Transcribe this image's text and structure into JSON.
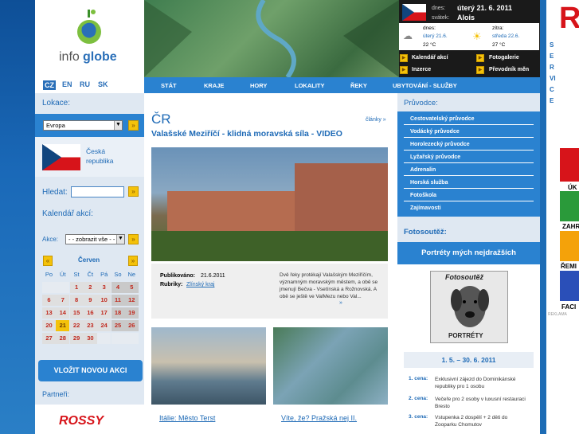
{
  "logo": {
    "text_info": "info",
    "text_globe": "globe"
  },
  "languages": [
    "CZ",
    "EN",
    "RU",
    "SK"
  ],
  "left": {
    "lokace_label": "Lokace:",
    "region_value": "Evropa",
    "country": "Česká republika",
    "search_label": "Hledat:",
    "calendar_label": "Kalendář akcí:",
    "events_label": "Akce:",
    "events_value": "- - zobrazit vše - -",
    "month": "Červen",
    "weekdays": [
      "Po",
      "Út",
      "St",
      "Čt",
      "Pá",
      "So",
      "Ne"
    ],
    "days": [
      "",
      "",
      "1",
      "2",
      "3",
      "4",
      "5",
      "6",
      "7",
      "8",
      "9",
      "10",
      "11",
      "12",
      "13",
      "14",
      "15",
      "16",
      "17",
      "18",
      "19",
      "20",
      "21",
      "22",
      "23",
      "24",
      "25",
      "26",
      "27",
      "28",
      "29",
      "30",
      "",
      "",
      ""
    ],
    "today": "21",
    "add_event_button": "VLOŽIT NOVOU AKCI",
    "partners_label": "Partneři:",
    "partner_logo": "ROSSY"
  },
  "weather": {
    "dnes_label": "dnes:",
    "date_today": "úterý 21. 6. 2011",
    "svatek_label": "svátek:",
    "name_day": "Alois",
    "today_label": "dnes:",
    "today_day": "úterý 21.6.",
    "today_temp": "22 °C",
    "tomorrow_label": "zítra:",
    "tomorrow_day": "středa 22.6.",
    "tomorrow_temp": "27 °C",
    "links": [
      "Kalendář akcí",
      "Fotogalerie",
      "Inzerce",
      "Převodník měn"
    ]
  },
  "nav": [
    "STÁT",
    "KRAJE",
    "HORY",
    "LOKALITY",
    "ŘEKY",
    "UBYTOVÁNÍ - SLUŽBY"
  ],
  "article": {
    "country": "ČR",
    "articles_link": "články »",
    "title": "Valašské Meziříčí - klidná moravská síla - VIDEO",
    "published_label": "Publikováno:",
    "published_date": "21.6.2011",
    "rubric_label": "Rubriky:",
    "rubric_value": "Zlínský kraj",
    "excerpt": "Dvě řeky protékají Valašským Meziříčím, významným moravským městem, a obě se jmenují Bečva - Vsetínská a Rožnovská. A obě se ještě ve ValMezu nebo Val...",
    "more": "»",
    "thumb1_title": "Itálie: Město Terst",
    "thumb2_title": "Víte, že? Pražská nej II."
  },
  "right": {
    "guide_label": "Průvodce:",
    "guides": [
      "Cestovatelský průvodce",
      "Vodácký průvodce",
      "Horolezecký průvodce",
      "Lyžařský průvodce",
      "Adrenalin",
      "Horská služba",
      "Fotoškola",
      "Zajímavosti"
    ],
    "contest_label": "Fotosoutěž:",
    "contest_title": "Portréty mých nejdražších",
    "poster_top": "Fotosoutěž",
    "poster_bottom": "PORTRÉTY",
    "dates": "1. 5. – 30. 6. 2011",
    "prizes": [
      {
        "label": "1. cena:",
        "text": "Exklusivní zájezd do Dominikánské republiky pro 1 osobu"
      },
      {
        "label": "2. cena:",
        "text": "Večeře pro 2 osoby v luxusní restauraci Bresto"
      },
      {
        "label": "3. cena:",
        "text": "Vstupenka 2 dospělí + 2 děti do Zooparku Chomutov"
      }
    ]
  },
  "ad": {
    "brand": "R",
    "vertical": "SERVICE",
    "labels": [
      "ÚK",
      "ZAHR",
      "ŘEMI",
      "FACI"
    ],
    "footer": "REKLAMA"
  },
  "colors": {
    "accent": "#2a82d0",
    "link": "#1e6ab6",
    "prize": "#c0281d",
    "button": "#f4c20a"
  }
}
